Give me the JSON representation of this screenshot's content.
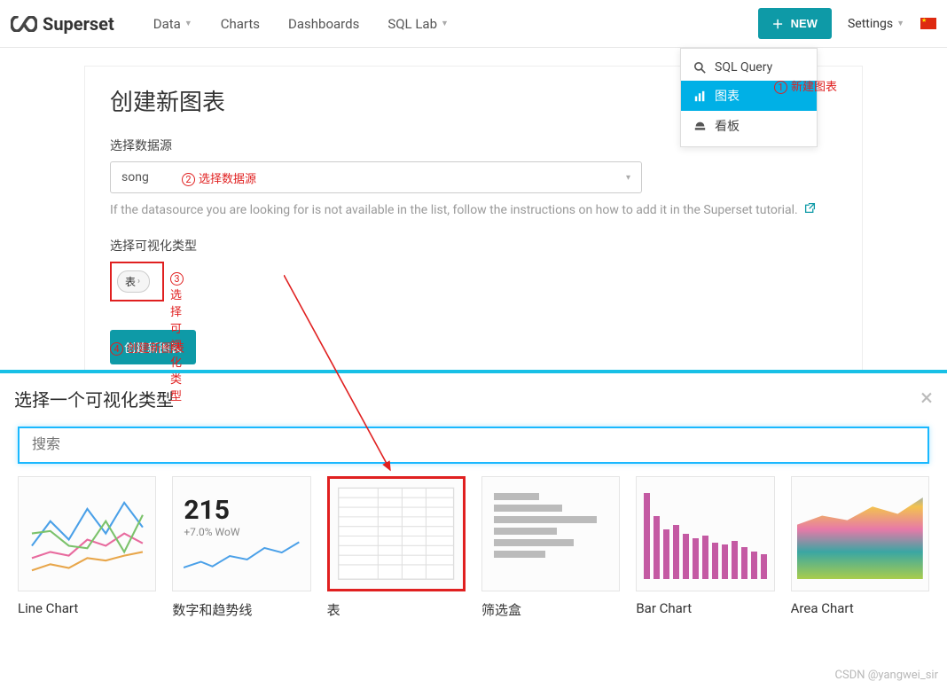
{
  "nav": {
    "brand": "Superset",
    "items": [
      "Data",
      "Charts",
      "Dashboards",
      "SQL Lab"
    ],
    "new_button": "NEW",
    "settings": "Settings"
  },
  "new_dropdown": {
    "items": [
      {
        "icon": "search",
        "label": "SQL Query"
      },
      {
        "icon": "chart-bar",
        "label": "图表",
        "active": true
      },
      {
        "icon": "dashboard",
        "label": "看板"
      }
    ]
  },
  "annotations": {
    "a1": "新建图表",
    "a2": "选择数据源",
    "a3": "选择可视化类型",
    "a4": "创建新图表"
  },
  "form": {
    "title": "创建新图表",
    "datasource_label": "选择数据源",
    "datasource_value": "song",
    "hint": "If the datasource you are looking for is not available in the list, follow the instructions on how to add it in the Superset tutorial.",
    "viz_label": "选择可视化类型",
    "viz_value": "表",
    "create_button": "创建新图表"
  },
  "modal": {
    "title": "选择一个可视化类型",
    "search_placeholder": "搜索",
    "viz_types": [
      {
        "name": "Line Chart"
      },
      {
        "name": "数字和趋势线",
        "big": "215",
        "sub": "+7.0% WoW"
      },
      {
        "name": "表",
        "selected": true
      },
      {
        "name": "筛选盒"
      },
      {
        "name": "Bar Chart"
      },
      {
        "name": "Area Chart"
      }
    ]
  },
  "watermark": "CSDN @yangwei_sir"
}
